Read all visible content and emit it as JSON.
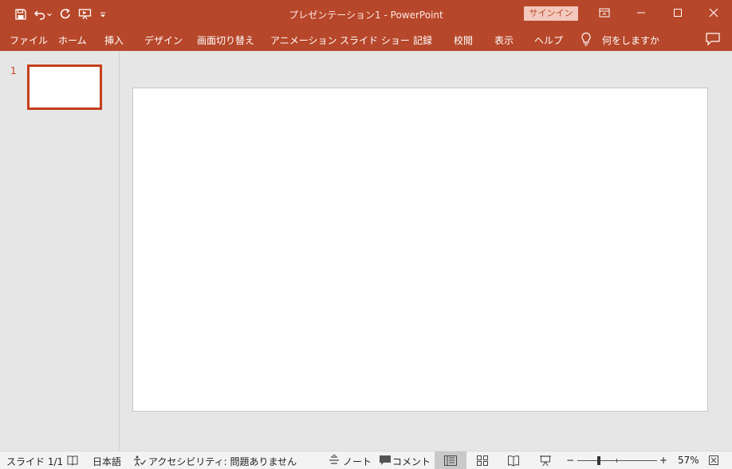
{
  "window": {
    "title": "プレゼンテーション1  -  PowerPoint",
    "signin_label": "サインイン",
    "accent_color": "#b7472a"
  },
  "quick_access": {
    "icons": [
      "save-icon",
      "undo-icon",
      "redo-icon",
      "present-from-start-icon",
      "customize-qat-icon"
    ]
  },
  "ribbon": {
    "tabs": [
      {
        "label": "ファイル"
      },
      {
        "label": "ホーム"
      },
      {
        "label": "挿入"
      },
      {
        "label": "デザイン"
      },
      {
        "label": "画面切り替え"
      },
      {
        "label": "アニメーション"
      },
      {
        "label": "スライド ショー"
      },
      {
        "label": "記録"
      },
      {
        "label": "校閲"
      },
      {
        "label": "表示"
      },
      {
        "label": "ヘルプ"
      }
    ],
    "tell_me": "何をしますか"
  },
  "thumbnails": {
    "items": [
      {
        "number": "1"
      }
    ]
  },
  "statusbar": {
    "slide_info": "スライド 1/1",
    "language": "日本語",
    "accessibility": "アクセシビリティ: 問題ありません",
    "notes_label": "ノート",
    "comments_label": "コメント",
    "zoom_minus": "−",
    "zoom_plus": "+",
    "zoom_percent": "57%",
    "zoom_level": 0.57
  }
}
